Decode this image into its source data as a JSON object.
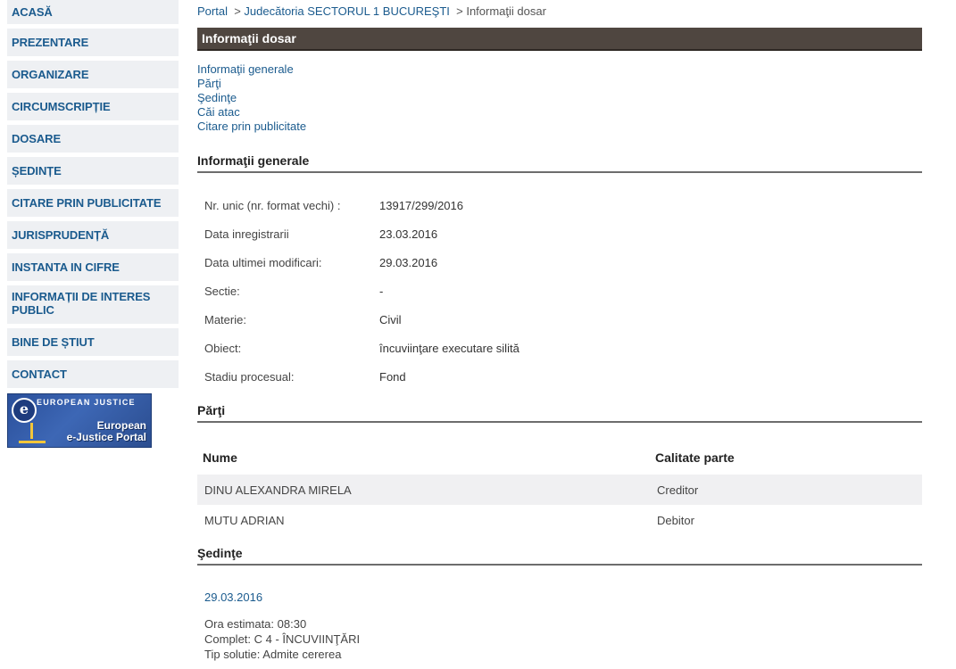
{
  "sidebar": {
    "items": [
      {
        "label": "ACASĂ"
      },
      {
        "label": "PREZENTARE"
      },
      {
        "label": "ORGANIZARE"
      },
      {
        "label": "CIRCUMSCRIPȚIE"
      },
      {
        "label": "DOSARE"
      },
      {
        "label": "ȘEDINȚE"
      },
      {
        "label": "CITARE PRIN PUBLICITATE"
      },
      {
        "label": "JURISPRUDENȚĂ"
      },
      {
        "label": "INSTANTA IN CIFRE"
      },
      {
        "label": "INFORMAȚII DE INTERES PUBLIC"
      },
      {
        "label": "BINE DE ȘTIUT"
      },
      {
        "label": "CONTACT"
      }
    ],
    "banner": {
      "logo_letter": "e",
      "top_text": "EUROPEAN JUSTICE",
      "bottom_line1": "European",
      "bottom_line2": "e-Justice Portal"
    }
  },
  "breadcrumb": {
    "portal": "Portal",
    "sep": ">",
    "court": "Judecătoria SECTORUL 1 BUCUREŞTI",
    "current": "Informaţii dosar"
  },
  "page_title": "Informaţii dosar",
  "toc": [
    "Informaţii generale",
    "Părţi",
    "Şedinţe",
    "Căi atac",
    "Citare prin publicitate"
  ],
  "general": {
    "heading": "Informaţii generale",
    "rows": [
      {
        "label": "Nr. unic (nr. format vechi) :",
        "value": "13917/299/2016"
      },
      {
        "label": "Data inregistrarii",
        "value": "23.03.2016"
      },
      {
        "label": "Data ultimei modificari:",
        "value": "29.03.2016"
      },
      {
        "label": "Sectie:",
        "value": "-"
      },
      {
        "label": "Materie:",
        "value": "Civil"
      },
      {
        "label": "Obiect:",
        "value": "încuviinţare executare silită"
      },
      {
        "label": "Stadiu procesual:",
        "value": "Fond"
      }
    ]
  },
  "parti": {
    "heading": "Părţi",
    "columns": [
      "Nume",
      "Calitate parte"
    ],
    "rows": [
      {
        "name": "DINU ALEXANDRA MIRELA",
        "role": "Creditor"
      },
      {
        "name": "MUTU ADRIAN",
        "role": "Debitor"
      }
    ]
  },
  "sedinte": {
    "heading": "Şedinţe",
    "date": "29.03.2016",
    "lines": [
      "Ora estimata: 08:30",
      "Complet: C 4 - ÎNCUVIINŢĂRI",
      "Tip solutie: Admite cererea"
    ]
  },
  "colors": {
    "link": "#1b5b8e",
    "title_bar": "#4f4640",
    "nav_bg": "#eef0f3"
  }
}
